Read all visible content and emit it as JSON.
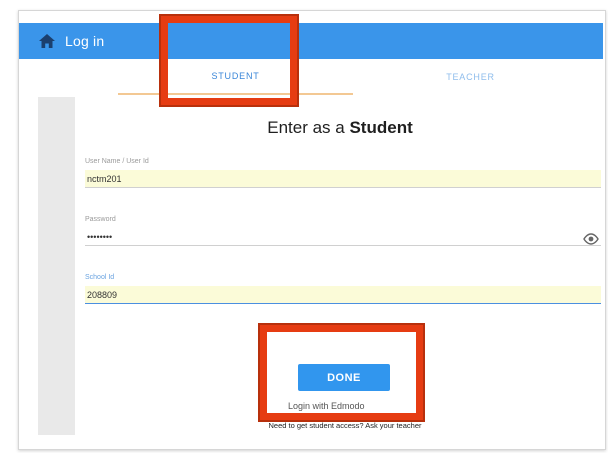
{
  "header": {
    "title": "Log in",
    "home_icon": "home-icon",
    "color": "#3a95ea"
  },
  "tabs": [
    {
      "label": "STUDENT",
      "active": true
    },
    {
      "label": "TEACHER",
      "active": false
    }
  ],
  "form": {
    "heading_prefix": "Enter as a ",
    "heading_role": "Student",
    "username": {
      "label": "User Name / User Id",
      "value": "nctm201"
    },
    "password": {
      "label": "Password",
      "value": "••••••••",
      "toggle_icon": "eye-icon"
    },
    "school": {
      "label": "School Id",
      "value": "208809"
    }
  },
  "actions": {
    "done_label": "DONE",
    "edmodo_label": "Login with Edmodo",
    "footer_note": "Need to get student access? Ask your teacher"
  },
  "highlight_color": "#e63c12"
}
